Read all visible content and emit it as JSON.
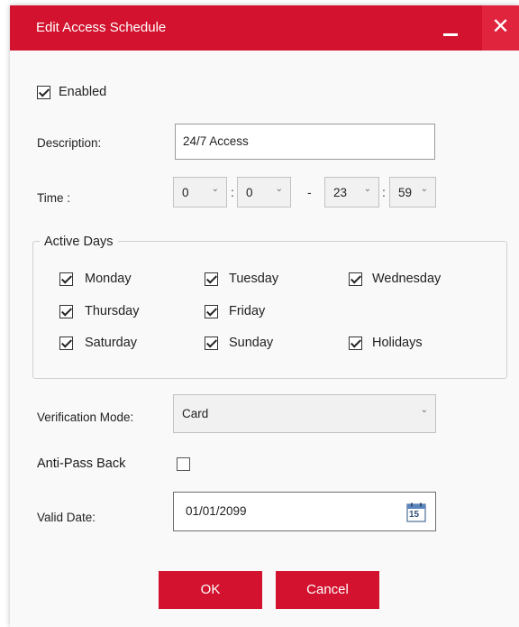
{
  "window": {
    "title": "Edit Access Schedule",
    "close_glyph": "✕",
    "accent_color": "#d2122e"
  },
  "enabled": {
    "label": "Enabled",
    "checked": true
  },
  "description": {
    "label": "Description:",
    "value": "24/7 Access"
  },
  "time": {
    "label": "Time :",
    "start_hour": "0",
    "start_minute": "0",
    "end_hour": "23",
    "end_minute": "59",
    "colon": ":",
    "dash": "-"
  },
  "active_days": {
    "title": "Active Days",
    "days": [
      {
        "label": "Monday",
        "checked": true
      },
      {
        "label": "Tuesday",
        "checked": true
      },
      {
        "label": "Wednesday",
        "checked": true
      },
      {
        "label": "Thursday",
        "checked": true
      },
      {
        "label": "Friday",
        "checked": true
      },
      {
        "label": "Saturday",
        "checked": true
      },
      {
        "label": "Sunday",
        "checked": true
      },
      {
        "label": "Holidays",
        "checked": true
      }
    ]
  },
  "verification": {
    "label": "Verification Mode:",
    "value": "Card"
  },
  "anti_pass_back": {
    "label": "Anti-Pass Back",
    "checked": false
  },
  "valid_date": {
    "label": "Valid Date:",
    "value": "01/01/2099",
    "calendar_day": "15"
  },
  "buttons": {
    "ok": "OK",
    "cancel": "Cancel"
  }
}
